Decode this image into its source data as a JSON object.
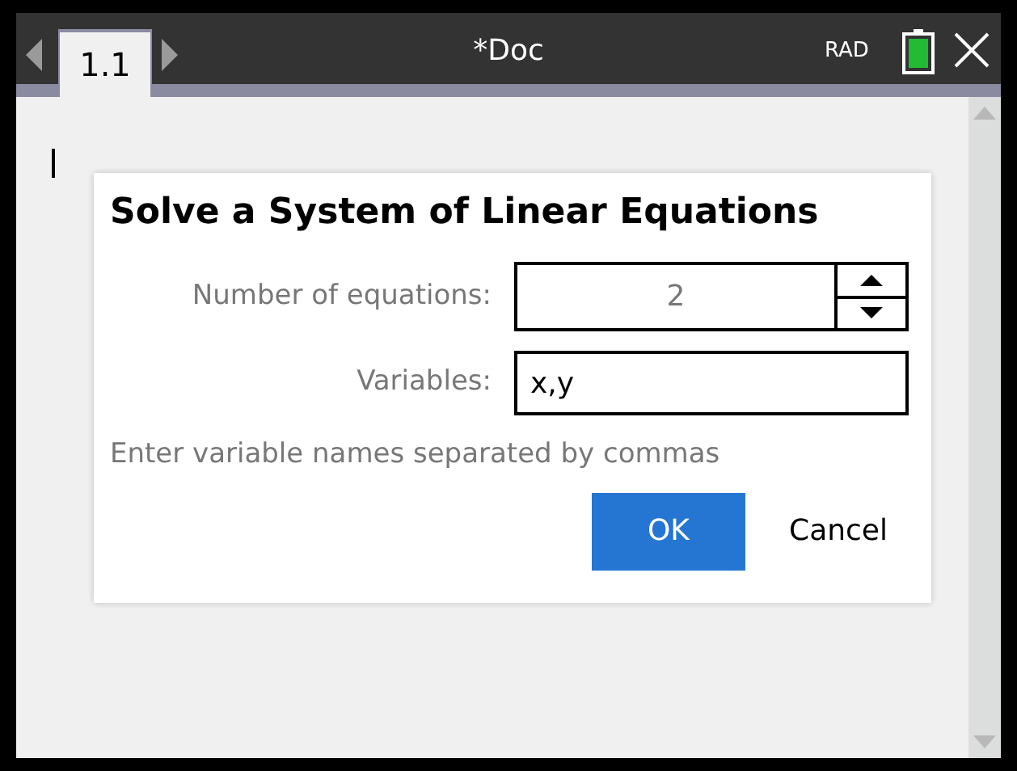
{
  "header": {
    "tab": {
      "label": "1.1",
      "selected": true
    },
    "title": "*Doc",
    "angle_mode": "RAD"
  },
  "dialog": {
    "title": "Solve a System of Linear Equations",
    "fields": [
      {
        "kind": "spinner",
        "label": "Number of equations:",
        "value": "2"
      },
      {
        "kind": "text",
        "label": "Variables:",
        "value": "x,y"
      }
    ],
    "hint": "Enter variable names separated by commas",
    "buttons": [
      {
        "label": "OK",
        "default": true
      },
      {
        "label": "Cancel",
        "default": false
      }
    ]
  }
}
